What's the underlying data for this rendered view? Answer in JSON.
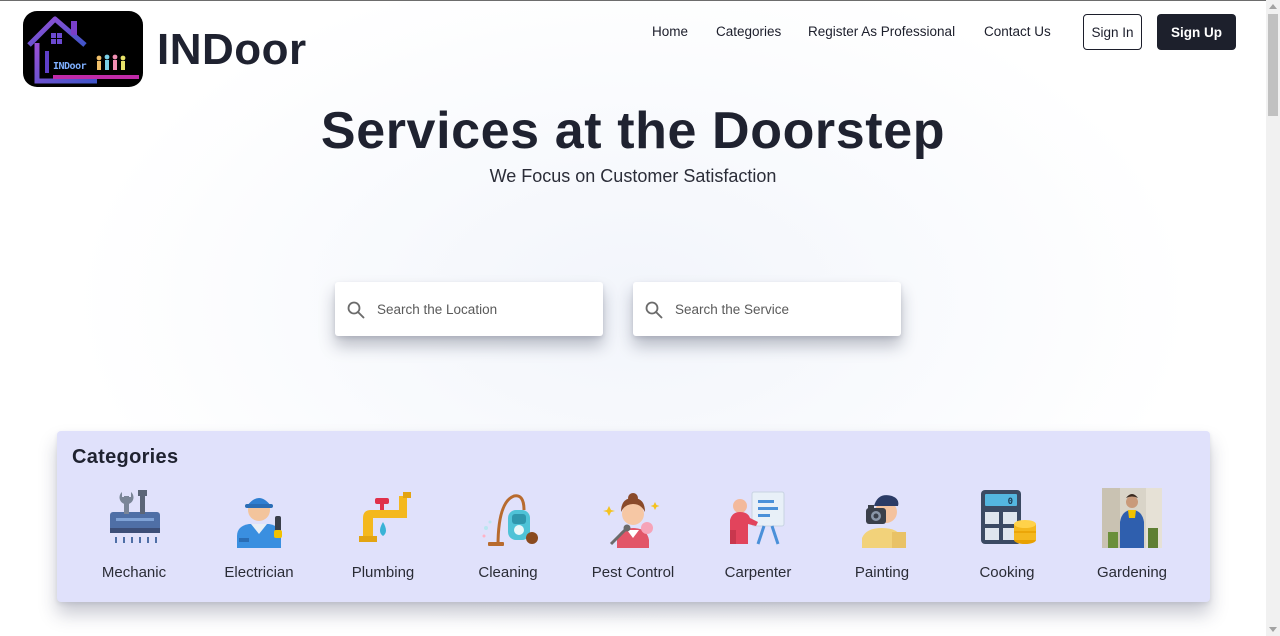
{
  "brand": {
    "name": "INDoor",
    "logo_text": "INDoor"
  },
  "nav": {
    "items": [
      {
        "label": "Home"
      },
      {
        "label": "Categories"
      },
      {
        "label": "Register As Professional"
      },
      {
        "label": "Contact Us"
      }
    ],
    "signin_label": "Sign In",
    "signup_label": "Sign Up"
  },
  "hero": {
    "title": "Services at the Doorstep",
    "subtitle": "We Focus on Customer Satisfaction"
  },
  "search": {
    "location_placeholder": "Search the Location",
    "location_value": "",
    "service_placeholder": "Search the Service",
    "service_value": ""
  },
  "categories": {
    "heading": "Categories",
    "items": [
      {
        "label": "Mechanic",
        "icon": "mechanic-icon"
      },
      {
        "label": "Electrician",
        "icon": "electrician-icon"
      },
      {
        "label": "Plumbing",
        "icon": "plumbing-icon"
      },
      {
        "label": "Cleaning",
        "icon": "cleaning-icon"
      },
      {
        "label": "Pest Control",
        "icon": "pest-control-icon"
      },
      {
        "label": "Carpenter",
        "icon": "carpenter-icon"
      },
      {
        "label": "Painting",
        "icon": "painting-icon"
      },
      {
        "label": "Cooking",
        "icon": "cooking-icon"
      },
      {
        "label": "Gardening",
        "icon": "gardening-icon"
      }
    ]
  },
  "colors": {
    "dark": "#1d202c",
    "panel": "#e0e1fb",
    "logo_accent": "#7a3fc9"
  }
}
